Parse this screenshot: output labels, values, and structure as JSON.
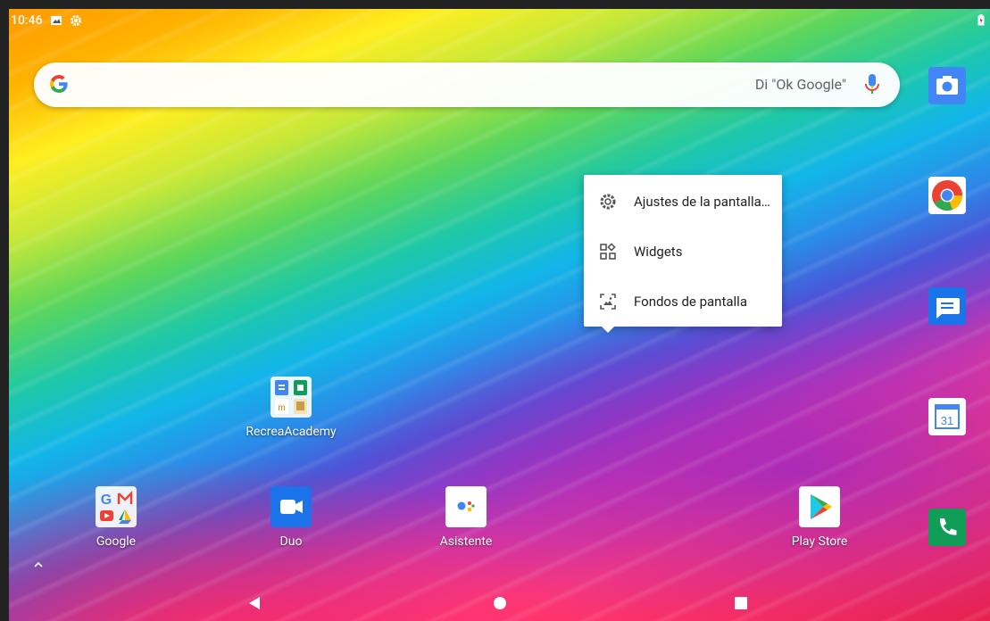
{
  "status_bar": {
    "time": "10:46",
    "icons": [
      "gallery-icon",
      "settings-icon"
    ],
    "battery": "battery-icon"
  },
  "search": {
    "hint": "Di \"Ok Google\"",
    "logo": "google-g-icon",
    "mic": "mic-icon"
  },
  "side_apps": [
    "camera-icon",
    "chrome-icon",
    "messages-icon",
    "calendar-icon",
    "phone-icon"
  ],
  "calendar_day": "31",
  "context_menu": {
    "items": [
      {
        "label": "Ajustes de la pantalla…",
        "icon": "gear-icon"
      },
      {
        "label": "Widgets",
        "icon": "widgets-icon"
      },
      {
        "label": "Fondos de pantalla",
        "icon": "wallpaper-icon"
      }
    ]
  },
  "home_apps": {
    "recrea": "RecreaAcademy",
    "google": "Google",
    "duo": "Duo",
    "asistente": "Asistente",
    "playstore": "Play Store"
  },
  "colors": {
    "chrome_red": "#ea4335",
    "chrome_yellow": "#fbbc05",
    "chrome_green": "#34a853",
    "google_blue": "#4285f4",
    "phone_green": "#0f9d58",
    "duo_blue": "#1a73e8"
  }
}
